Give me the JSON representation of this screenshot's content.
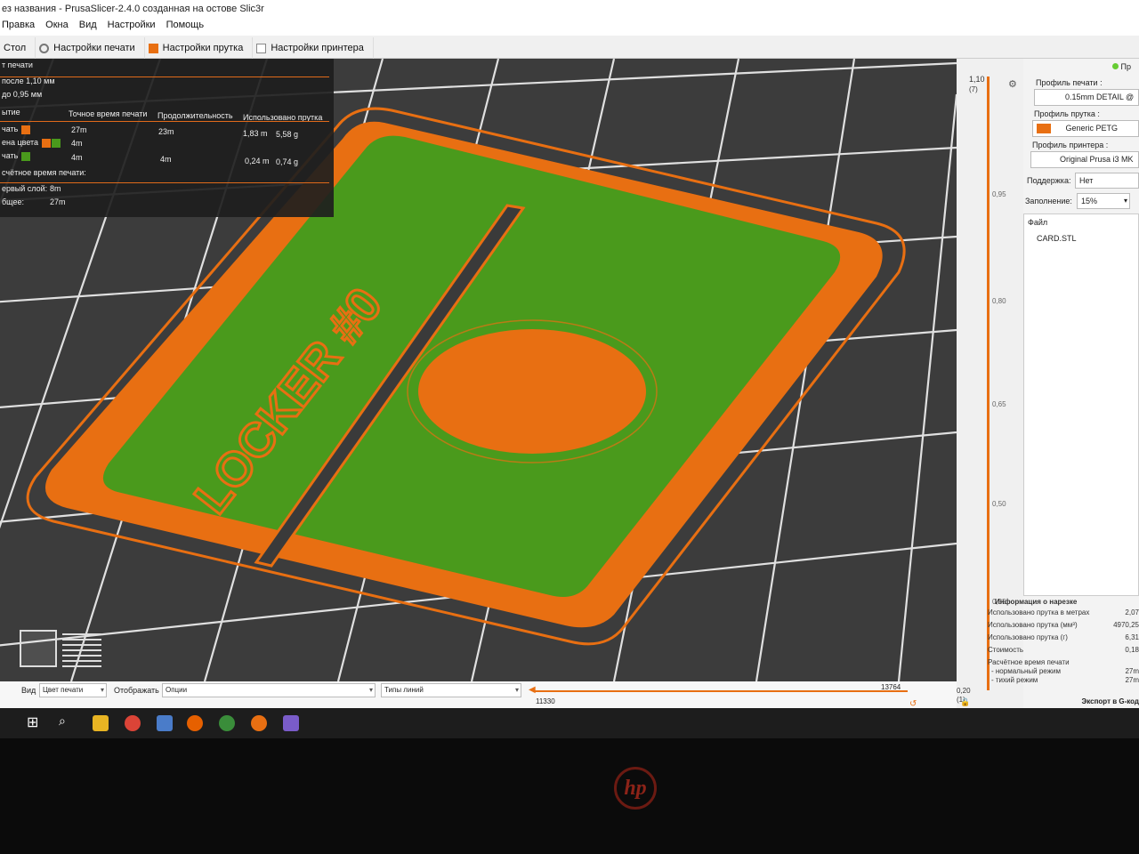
{
  "window": {
    "title": "ез названия - PrusaSlicer-2.4.0 созданная на остове Slic3r",
    "menu": [
      "Правка",
      "Окна",
      "Вид",
      "Настройки",
      "Помощь"
    ]
  },
  "tabs": [
    {
      "label": "Стол"
    },
    {
      "label": "Настройки печати"
    },
    {
      "label": "Настройки прутка"
    },
    {
      "label": "Настройки принтера"
    }
  ],
  "legend": {
    "title": "т печати",
    "layer_after": "после 1,10 мм",
    "layer_before": "до 0,95 мм",
    "headers": [
      "ытие",
      "Точное время печати",
      "Продолжительность",
      "Использовано прутка"
    ],
    "rows": [
      {
        "name": "чать",
        "time": "27m",
        "duration": "23m",
        "length": "1,83 m",
        "weight": "5,58 g"
      },
      {
        "name": "ена цвета",
        "time": "4m",
        "duration": "",
        "length": "",
        "weight": ""
      },
      {
        "name": "чать",
        "time": "4m",
        "duration": "4m",
        "length": "0,24 m",
        "weight": "0,74 g"
      }
    ],
    "estimated_label": "счётное время печати:",
    "first_layer_label": "ервый слой:",
    "first_layer_value": "8m",
    "total_label": "бщее:",
    "total_value": "27m"
  },
  "viewport": {
    "model_text": "LOCKER #0"
  },
  "bottombar": {
    "view_label": "Вид",
    "view_value": "Цвет печати",
    "show_label": "Отображать",
    "show_value": "Опции",
    "line_types_value": "Типы линий",
    "hslider_right": "13764",
    "hslider_left": "11330"
  },
  "vslider": {
    "top_value": "1,10",
    "top_layer": "(7)",
    "ticks": [
      "0,95",
      "0,80",
      "0,65",
      "0,50",
      "0,35"
    ],
    "bottom_value": "0,20",
    "bottom_layer": "(1)"
  },
  "sidebar": {
    "top_button": "Пр",
    "print_profile_label": "Профиль печати :",
    "print_profile_value": "0.15mm DETAIL @",
    "filament_profile_label": "Профиль прутка :",
    "filament_profile_value": "Generic PETG",
    "printer_profile_label": "Профиль принтера :",
    "printer_profile_value": "Original Prusa i3 MK",
    "support_label": "Поддержка:",
    "support_value": "Нет",
    "infill_label": "Заполнение:",
    "infill_value": "15%",
    "file_header": "Файл",
    "file_name": "CARD.STL",
    "export_button": "Экспорт в G-код"
  },
  "slice_info": {
    "title": "Информация о нарезке",
    "rows": [
      {
        "label": "Использовано прутка в метрах",
        "value": "2,07"
      },
      {
        "label": "Использовано прутка (мм³)",
        "value": "4970,25"
      },
      {
        "label": "Использовано прутка (г)",
        "value": "6,31"
      },
      {
        "label": "Стоимость",
        "value": "0,18"
      },
      {
        "label": "Расчётное время печати",
        "value": ""
      },
      {
        "label": "- нормальный режим",
        "value": "27m"
      },
      {
        "label": "- тихий режим",
        "value": "27m"
      }
    ]
  },
  "colors": {
    "orange": "#e86f12",
    "green": "#4a9a1c",
    "bed": "#3a3a3a",
    "accent": "#e06a1a"
  }
}
